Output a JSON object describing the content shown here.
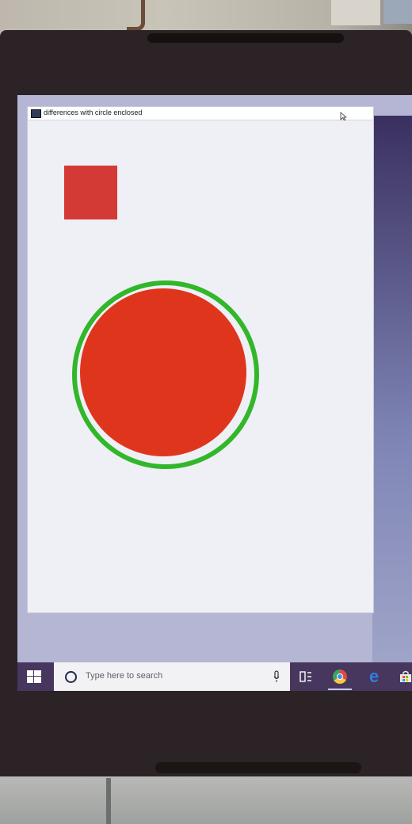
{
  "window": {
    "title": "differences with circle enclosed"
  },
  "canvas": {
    "shapes": [
      {
        "kind": "square",
        "color": "#d43a35"
      },
      {
        "kind": "circle",
        "fill": "#e0351d",
        "outline": "#32b72a"
      }
    ]
  },
  "taskbar": {
    "search_placeholder": "Type here to search",
    "icons": [
      "windows-start-icon",
      "search-icon",
      "microphone-icon",
      "task-view-icon",
      "chrome-icon",
      "edge-icon",
      "store-icon"
    ]
  }
}
